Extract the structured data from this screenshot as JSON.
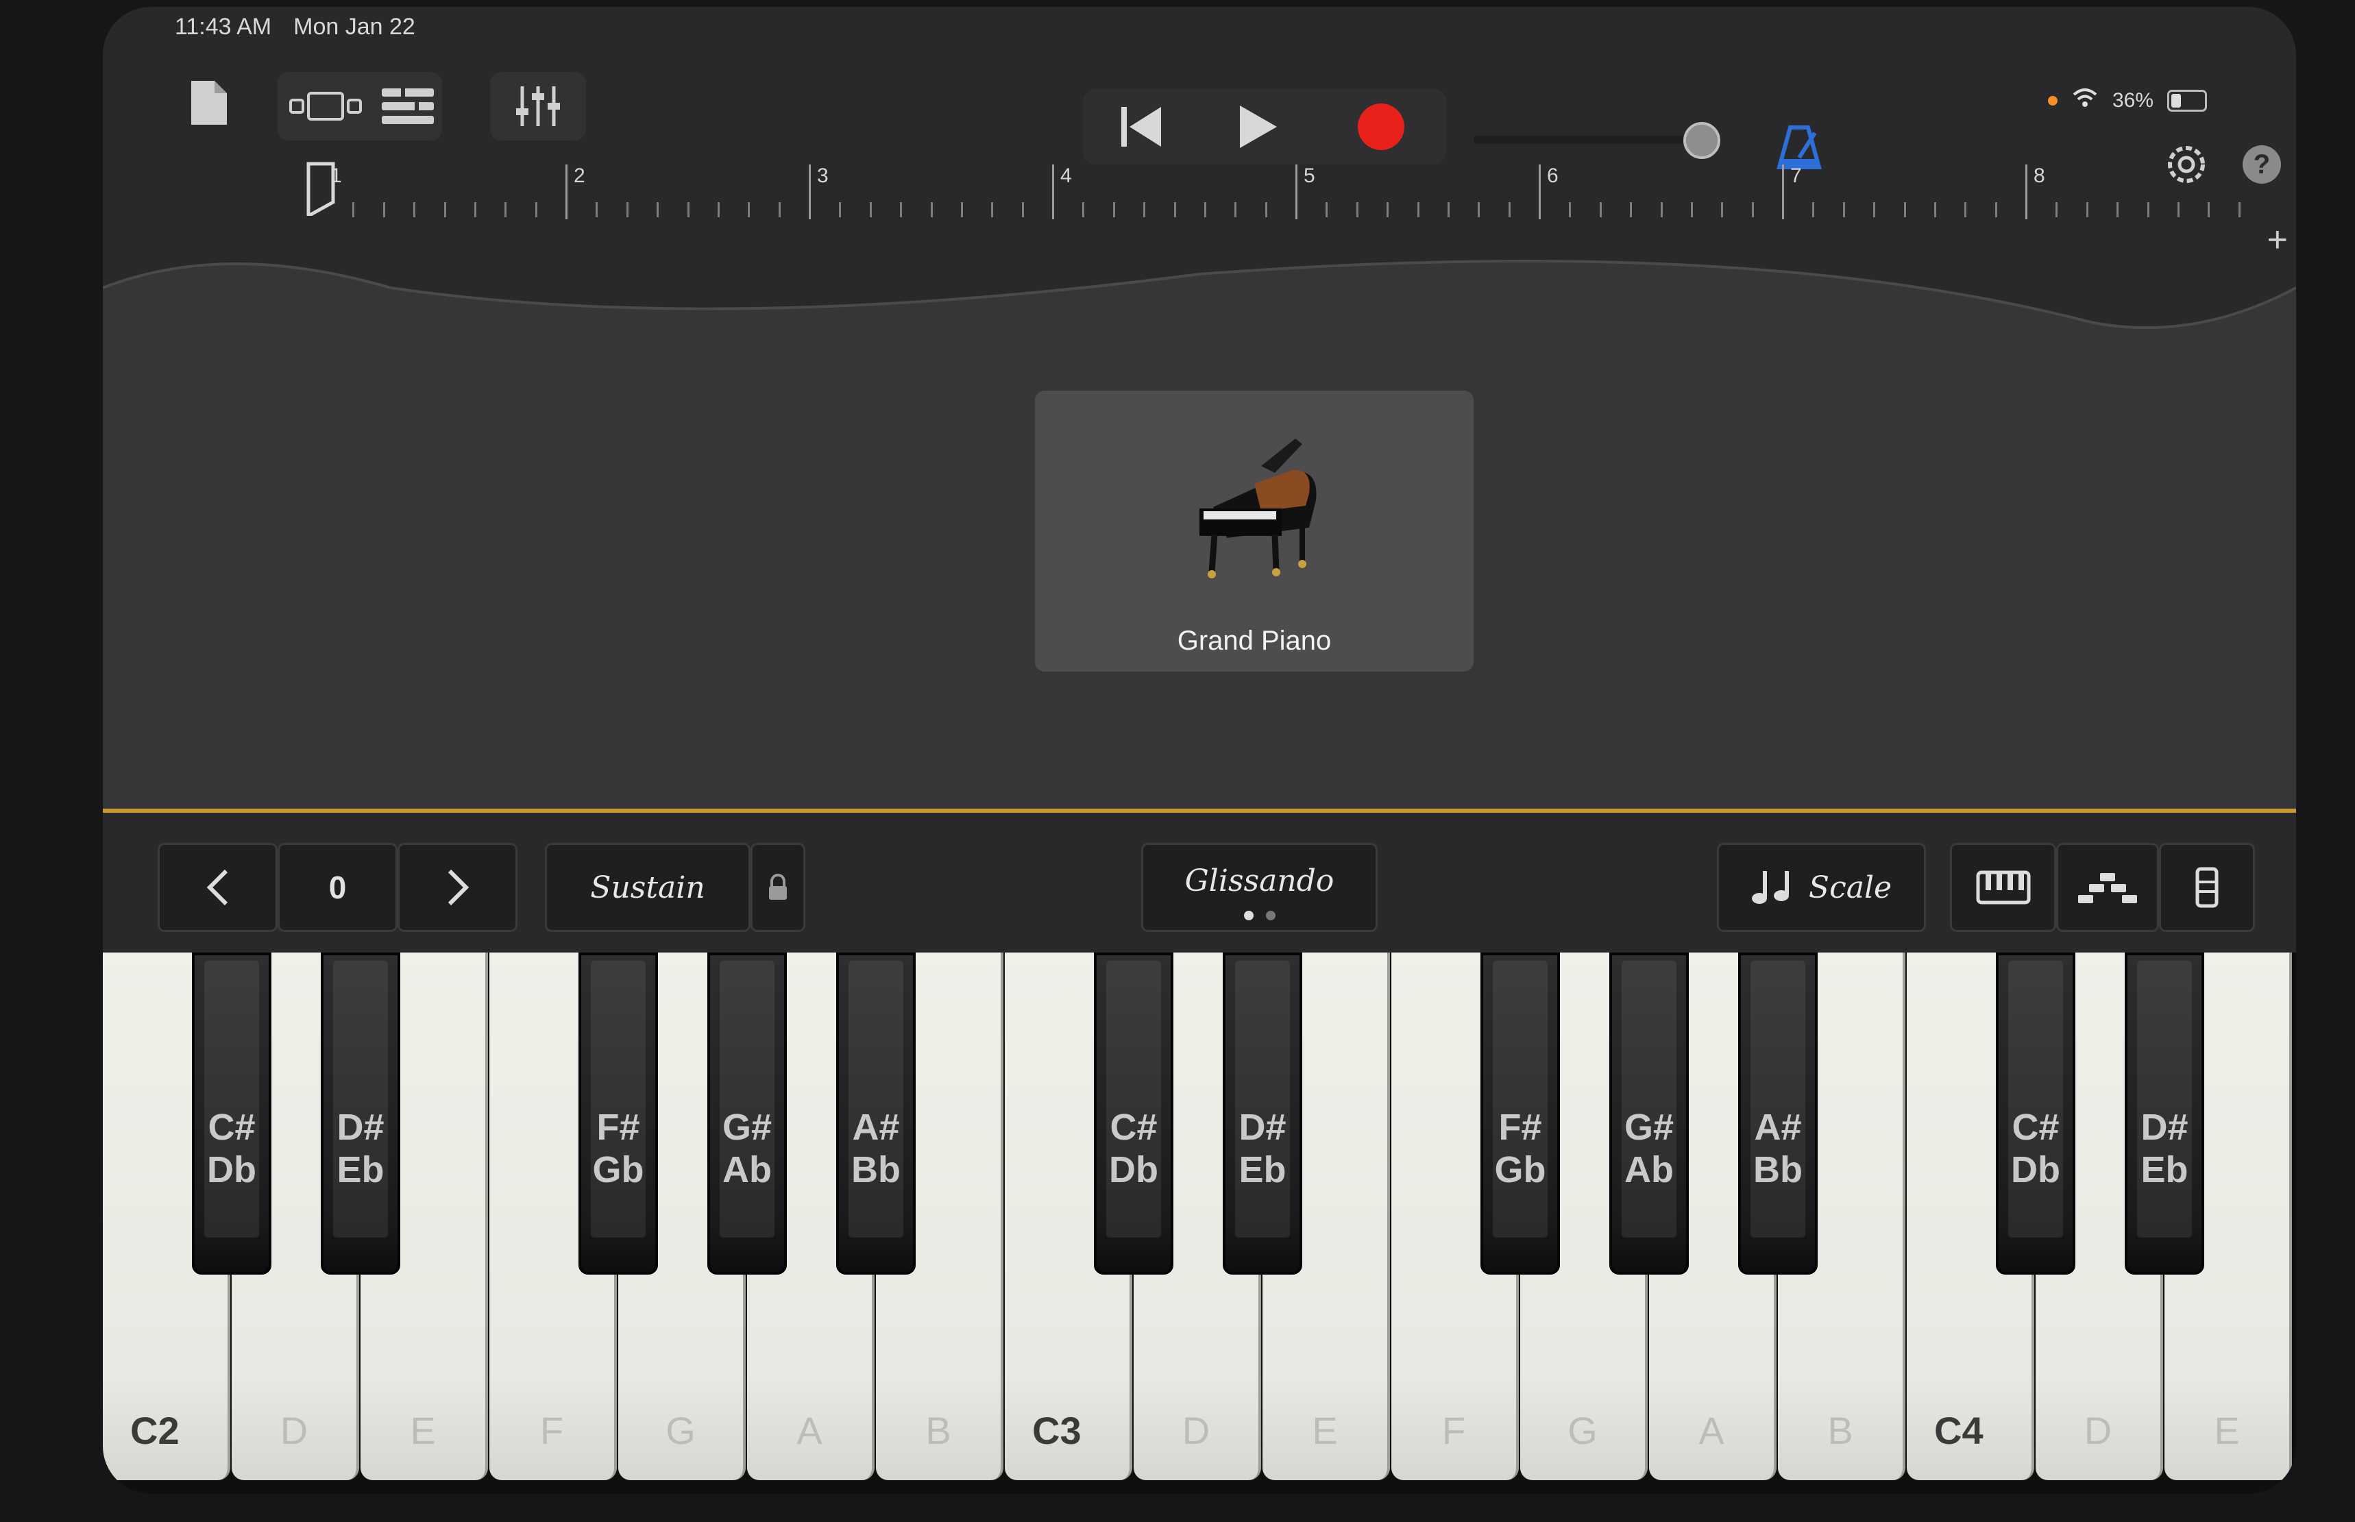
{
  "status": {
    "time": "11:43 AM",
    "date": "Mon Jan 22",
    "battery": "36%",
    "battery_fraction": 0.36
  },
  "toolbar": {
    "icons": [
      "document-icon",
      "tracks-view-icon",
      "track-list-icon",
      "mixer-icon",
      "rewind-icon",
      "play-icon",
      "record-icon",
      "metronome-icon",
      "settings-icon",
      "help-icon"
    ],
    "help_label": "?",
    "master_volume": 0.95
  },
  "ruler": {
    "bars": [
      "1",
      "2",
      "3",
      "4",
      "5",
      "6",
      "7",
      "8"
    ],
    "add_label": "+"
  },
  "instrument": {
    "name": "Grand Piano"
  },
  "controls": {
    "octave_value": "0",
    "sustain_label": "Sustain",
    "glissando_label": "Glissando",
    "scale_label": "Scale"
  },
  "colors": {
    "accent_gold": "#c99a2e",
    "record_red": "#e8211b",
    "metronome_blue": "#2d6fd8"
  },
  "keyboard": {
    "white_keys": [
      "C2",
      "D",
      "E",
      "F",
      "G",
      "A",
      "B",
      "C3",
      "D",
      "E",
      "F",
      "G",
      "A",
      "B",
      "C4",
      "D",
      "E"
    ],
    "black_keys": [
      {
        "top": "C#",
        "bottom": "Db"
      },
      {
        "top": "D#",
        "bottom": "Eb"
      },
      {
        "top": "F#",
        "bottom": "Gb"
      },
      {
        "top": "G#",
        "bottom": "Ab"
      },
      {
        "top": "A#",
        "bottom": "Bb"
      },
      {
        "top": "C#",
        "bottom": "Db"
      },
      {
        "top": "D#",
        "bottom": "Eb"
      },
      {
        "top": "F#",
        "bottom": "Gb"
      },
      {
        "top": "G#",
        "bottom": "Ab"
      },
      {
        "top": "A#",
        "bottom": "Bb"
      },
      {
        "top": "C#",
        "bottom": "Db"
      },
      {
        "top": "D#",
        "bottom": "Eb"
      }
    ]
  }
}
